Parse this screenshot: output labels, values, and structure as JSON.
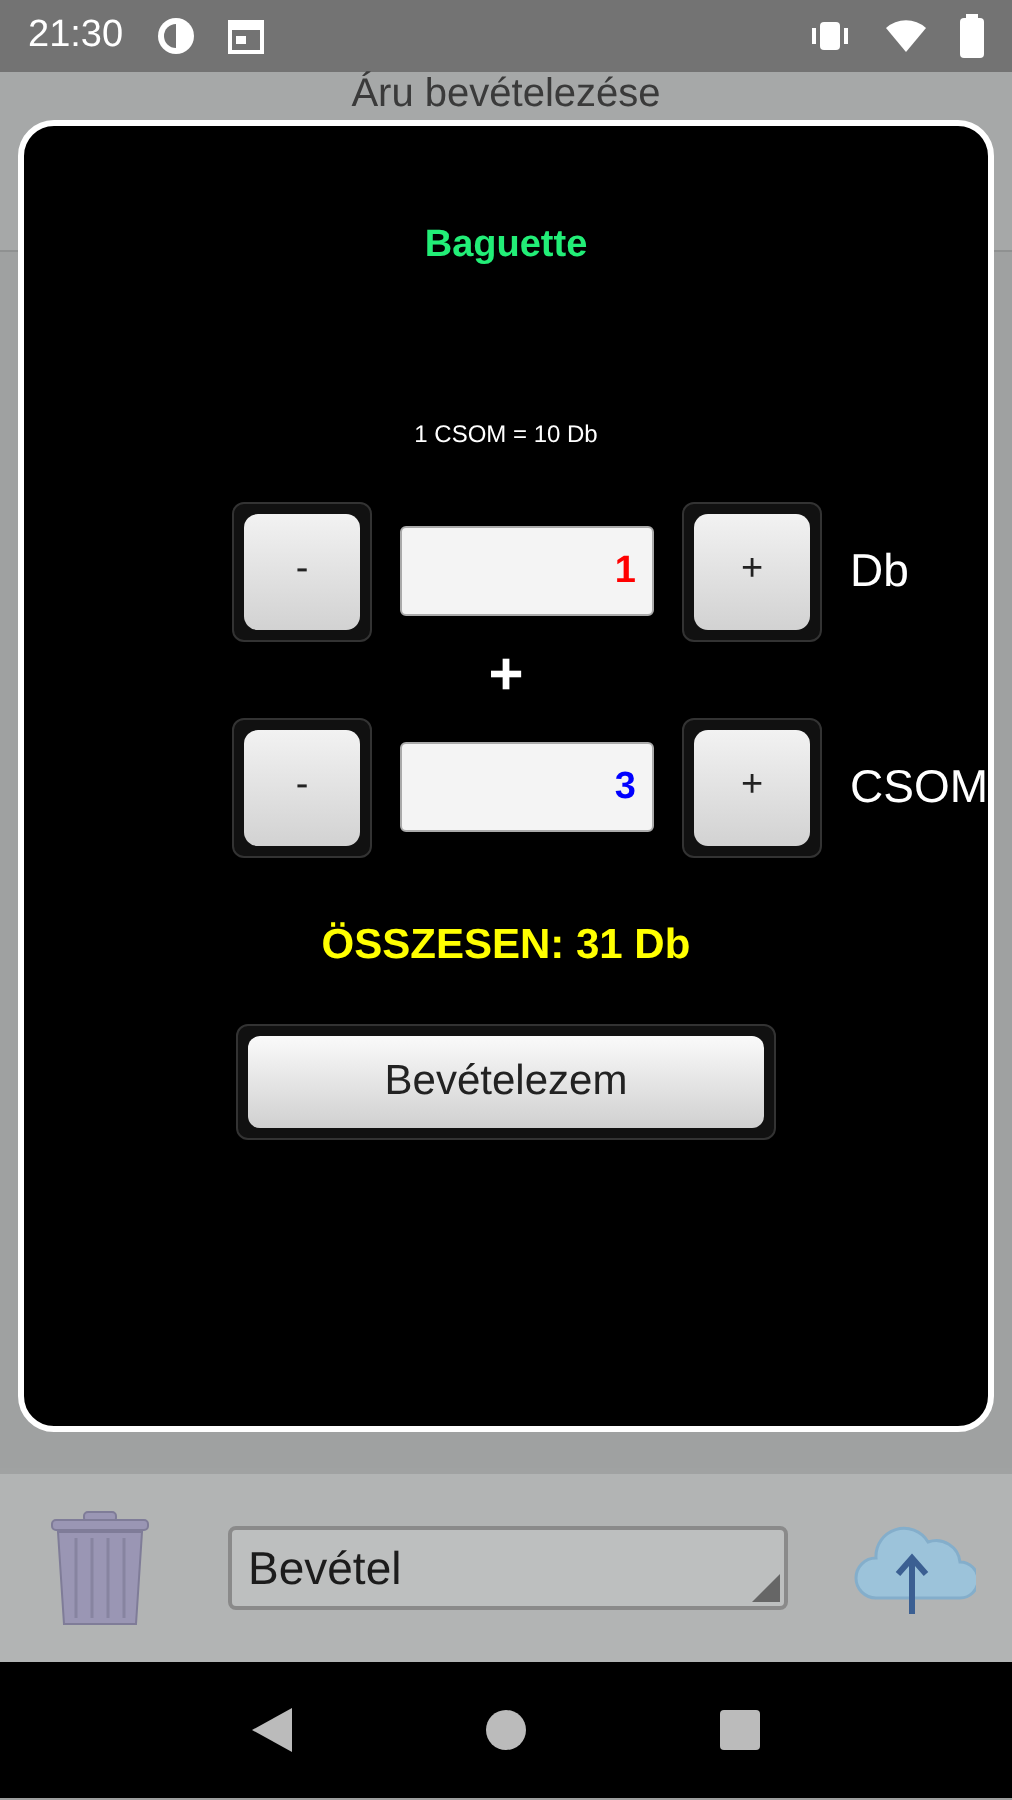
{
  "status_bar": {
    "time": "21:30"
  },
  "header": {
    "title": "Áru bevételezése"
  },
  "dialog": {
    "product": "Baguette",
    "conversion": "1 CSOM = 10 Db",
    "quantities": [
      {
        "minus": "-",
        "value": "1",
        "plus": "+",
        "unit": "Db",
        "color": "#ff0000"
      },
      {
        "minus": "-",
        "value": "3",
        "plus": "+",
        "unit": "CSOM",
        "color": "#0000ff"
      }
    ],
    "separator": "+",
    "total": "ÖSSZESEN: 31 Db",
    "submit": "Bevételezem"
  },
  "bottom_bar": {
    "type_select": "Bevétel"
  }
}
